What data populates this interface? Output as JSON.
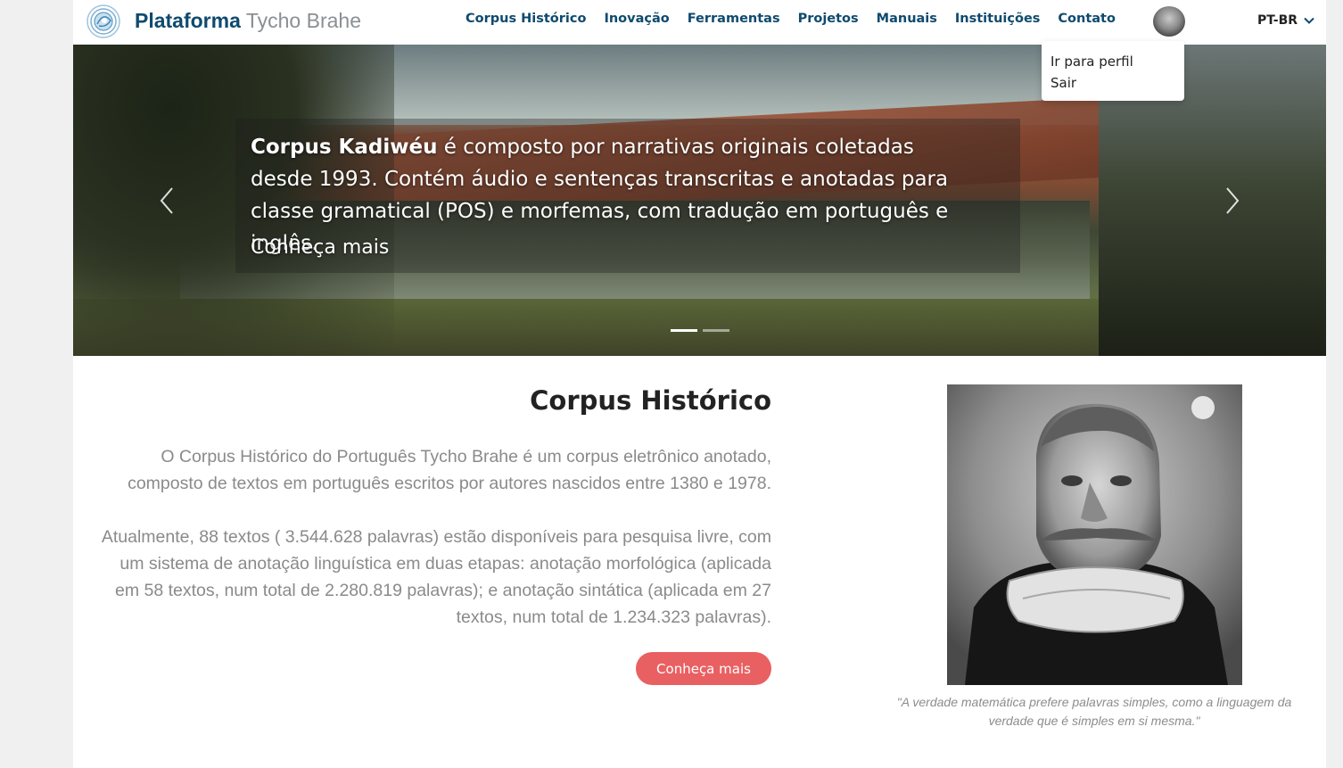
{
  "header": {
    "brand_bold": "Plataforma",
    "brand_light": "Tycho Brahe",
    "nav": [
      {
        "label": "Corpus Histórico"
      },
      {
        "label": "Inovação"
      },
      {
        "label": "Ferramentas"
      },
      {
        "label": "Projetos"
      },
      {
        "label": "Manuais"
      },
      {
        "label": "Instituições"
      },
      {
        "label": "Contato"
      }
    ],
    "language": "PT-BR",
    "profile_menu": [
      {
        "label": "Ir para perfil"
      },
      {
        "label": "Sair"
      }
    ]
  },
  "hero": {
    "title_bold": "Corpus Kadiwéu",
    "title_rest": " é composto por narrativas originais coletadas desde 1993. Contém áudio e sentenças transcritas e anotadas para classe gramatical (POS) e morfemas, com tradução em português e inglês.",
    "link": "Conheça mais",
    "slides": 2,
    "active_slide": 1
  },
  "main": {
    "title": "Corpus Histórico",
    "paragraph_1": "O Corpus Histórico do Português Tycho Brahe é um corpus eletrônico anotado, composto de textos em português escritos por autores nascidos entre 1380 e 1978.",
    "paragraph_2": "Atualmente, 88 textos ( 3.544.628 palavras) estão disponíveis para pesquisa livre, com um sistema de anotação linguística em duas etapas: anotação morfológica (aplicada em 58 textos, num total de 2.280.819 palavras); e anotação sintática (aplicada em 27 textos, num total de 1.234.323 palavras).",
    "button": "Conheça mais",
    "quote": "\"A verdade matemática prefere palavras simples, como a linguagem da verdade que é simples em si mesma.\""
  },
  "colors": {
    "brand": "#0f4a6e",
    "accent": "#e96062",
    "muted_text": "#8a8a8a"
  }
}
